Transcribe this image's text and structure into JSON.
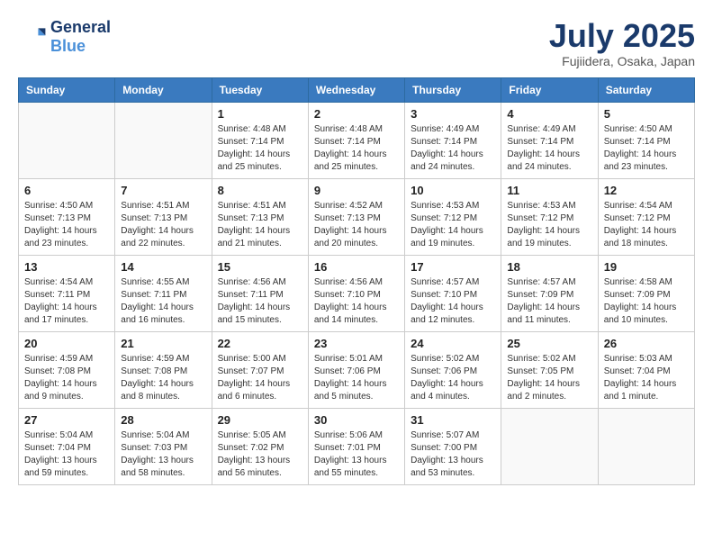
{
  "header": {
    "logo_line1": "General",
    "logo_line2": "Blue",
    "month_title": "July 2025",
    "subtitle": "Fujiidera, Osaka, Japan"
  },
  "weekdays": [
    "Sunday",
    "Monday",
    "Tuesday",
    "Wednesday",
    "Thursday",
    "Friday",
    "Saturday"
  ],
  "weeks": [
    [
      {
        "day": "",
        "info": ""
      },
      {
        "day": "",
        "info": ""
      },
      {
        "day": "1",
        "info": "Sunrise: 4:48 AM\nSunset: 7:14 PM\nDaylight: 14 hours and 25 minutes."
      },
      {
        "day": "2",
        "info": "Sunrise: 4:48 AM\nSunset: 7:14 PM\nDaylight: 14 hours and 25 minutes."
      },
      {
        "day": "3",
        "info": "Sunrise: 4:49 AM\nSunset: 7:14 PM\nDaylight: 14 hours and 24 minutes."
      },
      {
        "day": "4",
        "info": "Sunrise: 4:49 AM\nSunset: 7:14 PM\nDaylight: 14 hours and 24 minutes."
      },
      {
        "day": "5",
        "info": "Sunrise: 4:50 AM\nSunset: 7:14 PM\nDaylight: 14 hours and 23 minutes."
      }
    ],
    [
      {
        "day": "6",
        "info": "Sunrise: 4:50 AM\nSunset: 7:13 PM\nDaylight: 14 hours and 23 minutes."
      },
      {
        "day": "7",
        "info": "Sunrise: 4:51 AM\nSunset: 7:13 PM\nDaylight: 14 hours and 22 minutes."
      },
      {
        "day": "8",
        "info": "Sunrise: 4:51 AM\nSunset: 7:13 PM\nDaylight: 14 hours and 21 minutes."
      },
      {
        "day": "9",
        "info": "Sunrise: 4:52 AM\nSunset: 7:13 PM\nDaylight: 14 hours and 20 minutes."
      },
      {
        "day": "10",
        "info": "Sunrise: 4:53 AM\nSunset: 7:12 PM\nDaylight: 14 hours and 19 minutes."
      },
      {
        "day": "11",
        "info": "Sunrise: 4:53 AM\nSunset: 7:12 PM\nDaylight: 14 hours and 19 minutes."
      },
      {
        "day": "12",
        "info": "Sunrise: 4:54 AM\nSunset: 7:12 PM\nDaylight: 14 hours and 18 minutes."
      }
    ],
    [
      {
        "day": "13",
        "info": "Sunrise: 4:54 AM\nSunset: 7:11 PM\nDaylight: 14 hours and 17 minutes."
      },
      {
        "day": "14",
        "info": "Sunrise: 4:55 AM\nSunset: 7:11 PM\nDaylight: 14 hours and 16 minutes."
      },
      {
        "day": "15",
        "info": "Sunrise: 4:56 AM\nSunset: 7:11 PM\nDaylight: 14 hours and 15 minutes."
      },
      {
        "day": "16",
        "info": "Sunrise: 4:56 AM\nSunset: 7:10 PM\nDaylight: 14 hours and 14 minutes."
      },
      {
        "day": "17",
        "info": "Sunrise: 4:57 AM\nSunset: 7:10 PM\nDaylight: 14 hours and 12 minutes."
      },
      {
        "day": "18",
        "info": "Sunrise: 4:57 AM\nSunset: 7:09 PM\nDaylight: 14 hours and 11 minutes."
      },
      {
        "day": "19",
        "info": "Sunrise: 4:58 AM\nSunset: 7:09 PM\nDaylight: 14 hours and 10 minutes."
      }
    ],
    [
      {
        "day": "20",
        "info": "Sunrise: 4:59 AM\nSunset: 7:08 PM\nDaylight: 14 hours and 9 minutes."
      },
      {
        "day": "21",
        "info": "Sunrise: 4:59 AM\nSunset: 7:08 PM\nDaylight: 14 hours and 8 minutes."
      },
      {
        "day": "22",
        "info": "Sunrise: 5:00 AM\nSunset: 7:07 PM\nDaylight: 14 hours and 6 minutes."
      },
      {
        "day": "23",
        "info": "Sunrise: 5:01 AM\nSunset: 7:06 PM\nDaylight: 14 hours and 5 minutes."
      },
      {
        "day": "24",
        "info": "Sunrise: 5:02 AM\nSunset: 7:06 PM\nDaylight: 14 hours and 4 minutes."
      },
      {
        "day": "25",
        "info": "Sunrise: 5:02 AM\nSunset: 7:05 PM\nDaylight: 14 hours and 2 minutes."
      },
      {
        "day": "26",
        "info": "Sunrise: 5:03 AM\nSunset: 7:04 PM\nDaylight: 14 hours and 1 minute."
      }
    ],
    [
      {
        "day": "27",
        "info": "Sunrise: 5:04 AM\nSunset: 7:04 PM\nDaylight: 13 hours and 59 minutes."
      },
      {
        "day": "28",
        "info": "Sunrise: 5:04 AM\nSunset: 7:03 PM\nDaylight: 13 hours and 58 minutes."
      },
      {
        "day": "29",
        "info": "Sunrise: 5:05 AM\nSunset: 7:02 PM\nDaylight: 13 hours and 56 minutes."
      },
      {
        "day": "30",
        "info": "Sunrise: 5:06 AM\nSunset: 7:01 PM\nDaylight: 13 hours and 55 minutes."
      },
      {
        "day": "31",
        "info": "Sunrise: 5:07 AM\nSunset: 7:00 PM\nDaylight: 13 hours and 53 minutes."
      },
      {
        "day": "",
        "info": ""
      },
      {
        "day": "",
        "info": ""
      }
    ]
  ]
}
